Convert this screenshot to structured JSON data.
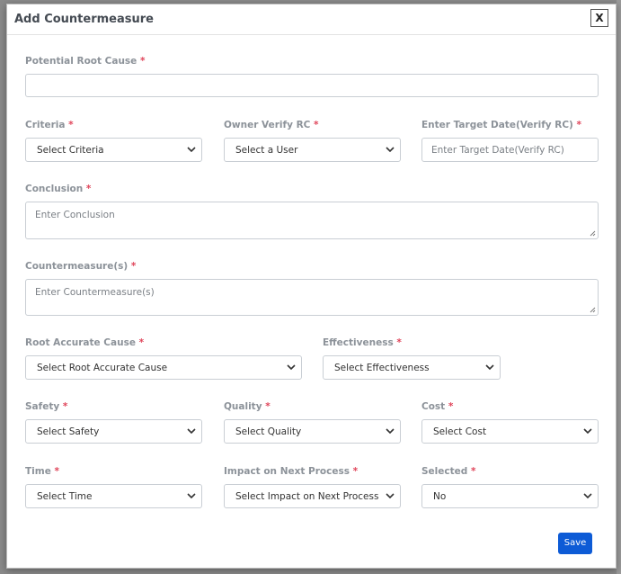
{
  "modal": {
    "title": "Add Countermeasure",
    "close_label": "X",
    "save_label": "Save"
  },
  "fields": {
    "potential_root_cause": {
      "label": "Potential Root Cause",
      "required_mark": "*",
      "value": ""
    },
    "criteria": {
      "label": "Criteria",
      "required_mark": "*",
      "value": "Select Criteria"
    },
    "owner_verify_rc": {
      "label": "Owner Verify RC",
      "required_mark": "*",
      "value": "Select a User"
    },
    "target_date": {
      "label": "Enter Target Date(Verify RC)",
      "required_mark": "*",
      "placeholder": "Enter Target Date(Verify RC)"
    },
    "conclusion": {
      "label": "Conclusion",
      "required_mark": "*",
      "placeholder": "Enter Conclusion"
    },
    "countermeasures": {
      "label": "Countermeasure(s)",
      "required_mark": "*",
      "placeholder": "Enter Countermeasure(s)"
    },
    "root_accurate_cause": {
      "label": "Root Accurate Cause",
      "required_mark": "*",
      "value": "Select Root Accurate Cause"
    },
    "effectiveness": {
      "label": "Effectiveness",
      "required_mark": "*",
      "value": "Select Effectiveness"
    },
    "safety": {
      "label": "Safety",
      "required_mark": "*",
      "value": "Select Safety"
    },
    "quality": {
      "label": "Quality",
      "required_mark": "*",
      "value": "Select Quality"
    },
    "cost": {
      "label": "Cost",
      "required_mark": "*",
      "value": "Select Cost"
    },
    "time": {
      "label": "Time",
      "required_mark": "*",
      "value": "Select Time"
    },
    "impact_next_process": {
      "label": "Impact on Next Process",
      "required_mark": "*",
      "value": "Select Impact on Next Process"
    },
    "selected": {
      "label": "Selected",
      "required_mark": "*",
      "value": "No"
    }
  },
  "colors": {
    "label": "#8c9299",
    "required": "#e0455a",
    "primary_button": "#0d5bd6",
    "border": "#c9ced4"
  }
}
